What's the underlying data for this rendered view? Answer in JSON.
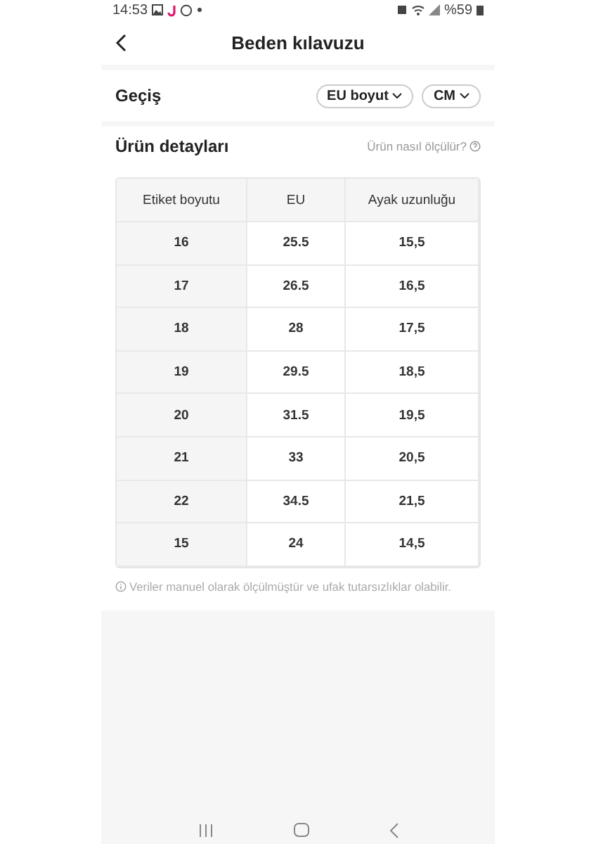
{
  "status_bar": {
    "time": "14:53",
    "battery": "%59"
  },
  "header": {
    "title": "Beden kılavuzu"
  },
  "conversion": {
    "label": "Geçiş",
    "dropdowns": [
      "EU boyut",
      "CM"
    ]
  },
  "details": {
    "title": "Ürün detayları",
    "help_link": "Ürün nasıl ölçülür?"
  },
  "table": {
    "columns": [
      "Etiket boyutu",
      "EU",
      "Ayak uzunluğu"
    ],
    "rows": [
      [
        "16",
        "25.5",
        "15,5"
      ],
      [
        "17",
        "26.5",
        "16,5"
      ],
      [
        "18",
        "28",
        "17,5"
      ],
      [
        "19",
        "29.5",
        "18,5"
      ],
      [
        "20",
        "31.5",
        "19,5"
      ],
      [
        "21",
        "33",
        "20,5"
      ],
      [
        "22",
        "34.5",
        "21,5"
      ],
      [
        "15",
        "24",
        "14,5"
      ]
    ]
  },
  "note": "Veriler manuel olarak ölçülmüştür ve ufak tutarsızlıklar olabilir."
}
